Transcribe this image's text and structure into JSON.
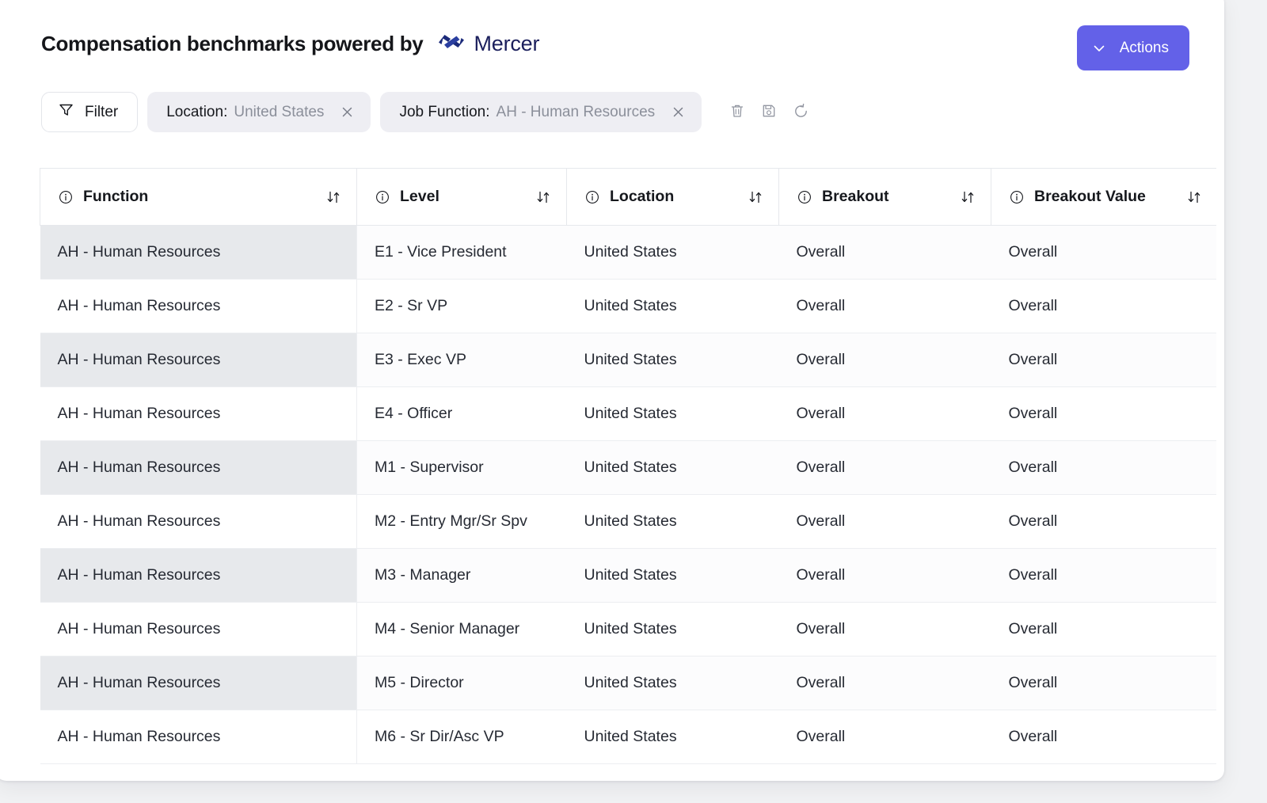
{
  "header": {
    "title_prefix": "Compensation benchmarks powered by",
    "brand_name": "Mercer",
    "brand_logo_icon": "mercer-logo-icon",
    "brand_color": "#1b1f5c",
    "actions_button": {
      "label": "Actions",
      "icon": "chevron-down-icon",
      "color": "#6361e8"
    }
  },
  "filter_bar": {
    "filter_button": {
      "label": "Filter",
      "icon": "funnel-icon"
    },
    "chips": [
      {
        "key": "Location:",
        "value": "United States",
        "remove_icon": "close-icon"
      },
      {
        "key": "Job Function:",
        "value": "AH - Human Resources",
        "remove_icon": "close-icon"
      }
    ],
    "tools": [
      {
        "name": "delete-filters-button",
        "icon": "trash-icon"
      },
      {
        "name": "save-filters-button",
        "icon": "save-disk-icon"
      },
      {
        "name": "reset-filters-button",
        "icon": "reset-arrow-icon"
      }
    ]
  },
  "table": {
    "columns": [
      {
        "label": "Function",
        "info_icon": "info-circle-icon",
        "sort_icon": "sort-updown-icon"
      },
      {
        "label": "Level",
        "info_icon": "info-circle-icon",
        "sort_icon": "sort-updown-icon"
      },
      {
        "label": "Location",
        "info_icon": "info-circle-icon",
        "sort_icon": "sort-updown-icon"
      },
      {
        "label": "Breakout",
        "info_icon": "info-circle-icon",
        "sort_icon": "sort-updown-icon"
      },
      {
        "label": "Breakout Value",
        "info_icon": "info-circle-icon",
        "sort_icon": "sort-updown-icon"
      }
    ],
    "rows": [
      {
        "function": "AH - Human Resources",
        "level": "E1 - Vice President",
        "location": "United States",
        "breakout": "Overall",
        "breakout_value": "Overall"
      },
      {
        "function": "AH - Human Resources",
        "level": "E2 - Sr VP",
        "location": "United States",
        "breakout": "Overall",
        "breakout_value": "Overall"
      },
      {
        "function": "AH - Human Resources",
        "level": "E3 - Exec VP",
        "location": "United States",
        "breakout": "Overall",
        "breakout_value": "Overall"
      },
      {
        "function": "AH - Human Resources",
        "level": "E4 - Officer",
        "location": "United States",
        "breakout": "Overall",
        "breakout_value": "Overall"
      },
      {
        "function": "AH - Human Resources",
        "level": "M1 - Supervisor",
        "location": "United States",
        "breakout": "Overall",
        "breakout_value": "Overall"
      },
      {
        "function": "AH - Human Resources",
        "level": "M2 - Entry Mgr/Sr Spv",
        "location": "United States",
        "breakout": "Overall",
        "breakout_value": "Overall"
      },
      {
        "function": "AH - Human Resources",
        "level": "M3 - Manager",
        "location": "United States",
        "breakout": "Overall",
        "breakout_value": "Overall"
      },
      {
        "function": "AH - Human Resources",
        "level": "M4 - Senior Manager",
        "location": "United States",
        "breakout": "Overall",
        "breakout_value": "Overall"
      },
      {
        "function": "AH - Human Resources",
        "level": "M5 - Director",
        "location": "United States",
        "breakout": "Overall",
        "breakout_value": "Overall"
      },
      {
        "function": "AH - Human Resources",
        "level": "M6 - Sr Dir/Asc VP",
        "location": "United States",
        "breakout": "Overall",
        "breakout_value": "Overall"
      }
    ]
  }
}
